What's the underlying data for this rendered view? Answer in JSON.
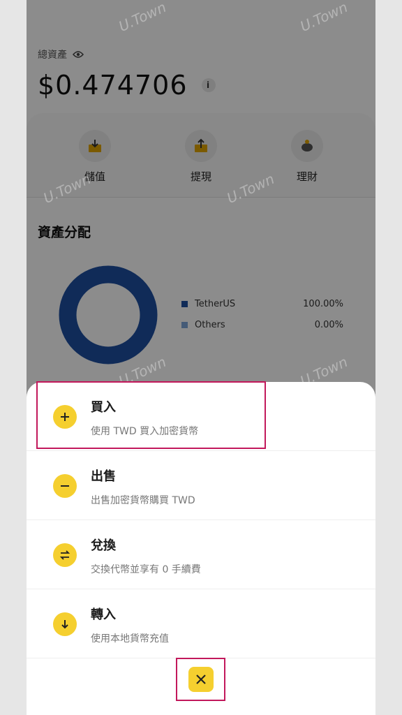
{
  "colors": {
    "accent": "#F5CF2F",
    "highlight": "#C2185B",
    "tether": "#1E4FA0",
    "others": "#7FA7D9"
  },
  "wallet": {
    "total_label": "總資產",
    "balance": "$0.474706",
    "info_glyph": "i"
  },
  "actions": [
    {
      "label": "儲值",
      "icon": "deposit-icon"
    },
    {
      "label": "提現",
      "icon": "withdraw-icon"
    },
    {
      "label": "理財",
      "icon": "piggy-bank-icon"
    }
  ],
  "allocation": {
    "title": "資產分配",
    "legend": [
      {
        "name": "TetherUS",
        "percent": "100.00%"
      },
      {
        "name": "Others",
        "percent": "0.00%"
      }
    ]
  },
  "chart_data": {
    "type": "pie",
    "categories": [
      "TetherUS",
      "Others"
    ],
    "values": [
      100.0,
      0.0
    ],
    "title": ""
  },
  "watermark": "U.Town",
  "sheet": {
    "items": [
      {
        "title": "買入",
        "subtitle": "使用 TWD 買入加密貨幣",
        "icon": "plus-icon"
      },
      {
        "title": "出售",
        "subtitle": "出售加密貨幣購買 TWD",
        "icon": "minus-icon"
      },
      {
        "title": "兌換",
        "subtitle": "交換代幣並享有 0 手續費",
        "icon": "swap-icon"
      },
      {
        "title": "轉入",
        "subtitle": "使用本地貨幣充值",
        "icon": "arrow-down-icon"
      }
    ],
    "close_icon": "close-icon"
  }
}
